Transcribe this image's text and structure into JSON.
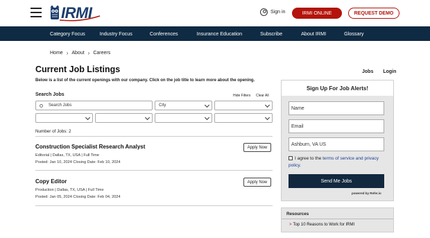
{
  "header": {
    "logo_text": "IRMI",
    "signin_label": "Sign in",
    "online_button": "IRMI ONLINE",
    "demo_button": "REQUEST DEMO",
    "brand_red": "#b3140b",
    "brand_navy": "#1d3e6e"
  },
  "nav": {
    "items": [
      "Category Focus",
      "Industry Focus",
      "Conferences",
      "Insurance Education",
      "Subscribe",
      "About IRMI",
      "Glossary"
    ],
    "bg_color": "#0f2a43"
  },
  "breadcrumb": [
    "Home",
    "About",
    "Careers"
  ],
  "main": {
    "title": "Current Job Listings",
    "intro": "Below is a list of the current openings with our company. Click on the job title to learn more about the opening.",
    "top_links": [
      "Jobs",
      "Login"
    ],
    "search_label": "Search Jobs",
    "hide_filters": "Hide Filters",
    "clear_all": "Clear All",
    "search_placeholder": "Search Jobs",
    "city_placeholder": "City",
    "num_jobs": "Number of Jobs: 2"
  },
  "jobs": [
    {
      "title": "Construction Specialist Research Analyst",
      "category_line": "Editorial | Dallas, TX, USA | Full Time",
      "dates": "Posted: Jan 10, 2024   Closing Date: Feb 10, 2024",
      "apply": "Apply Now"
    },
    {
      "title": "Copy Editor",
      "category_line": "Production | Dallas, TX, USA | Full Time",
      "dates": "Posted: Jan 05, 2024   Closing Date: Feb 04, 2024",
      "apply": "Apply Now"
    }
  ],
  "alerts": {
    "title": "Sign Up For Job Alerts!",
    "name_placeholder": "Name",
    "email_placeholder": "Email",
    "location_value": "Ashburn, VA US",
    "agree_prefix": "I agree to the ",
    "agree_link": "terms of service and privacy policy.",
    "send_button": "Send Me Jobs",
    "powered_by": "powered by Refer.io"
  },
  "resources": {
    "heading": "Resources",
    "link": "Top 10 Reasons to Work for IRMI"
  }
}
